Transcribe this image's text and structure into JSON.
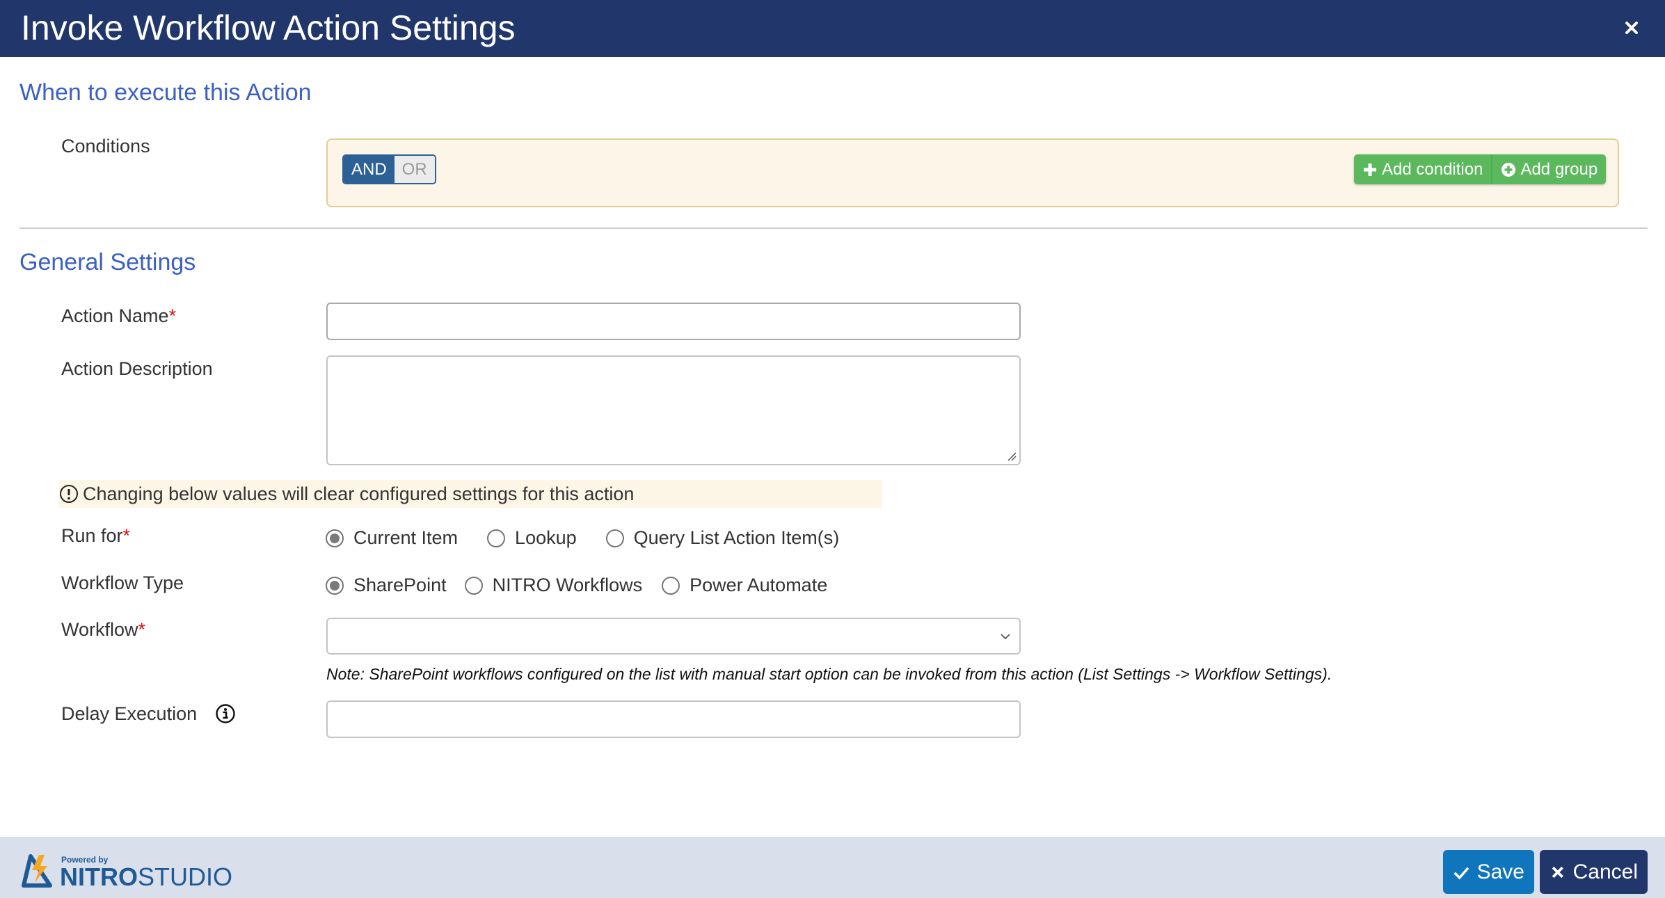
{
  "window": {
    "title": "Invoke Workflow Action Settings",
    "close_icon": "close-icon"
  },
  "when_section": {
    "heading": "When to execute this Action",
    "conditions_label": "Conditions",
    "logic_toggle": {
      "options": [
        "AND",
        "OR"
      ],
      "selected": "AND"
    },
    "add_condition_label": "Add condition",
    "add_group_label": "Add group"
  },
  "general_section": {
    "heading": "General Settings",
    "action_name": {
      "label": "Action Name",
      "required_mark": "*",
      "value": ""
    },
    "action_description": {
      "label": "Action Description",
      "value": ""
    },
    "warning": "Changing below values will clear configured settings for this action",
    "run_for": {
      "label": "Run for",
      "required_mark": "*",
      "options": [
        "Current Item",
        "Lookup",
        "Query List Action Item(s)"
      ],
      "selected": "Current Item"
    },
    "workflow_type": {
      "label": "Workflow Type",
      "options": [
        "SharePoint",
        "NITRO Workflows",
        "Power Automate"
      ],
      "selected": "SharePoint"
    },
    "workflow": {
      "label": "Workflow",
      "required_mark": "*",
      "selected_value": "",
      "note": "Note: SharePoint workflows configured on the list with manual start option can be invoked from this action (List Settings -> Workflow Settings)."
    },
    "delay_execution": {
      "label": "Delay Execution",
      "value": ""
    }
  },
  "footer": {
    "powered_by": "Powered by",
    "brand_bold": "NITRO",
    "brand_light": "STUDIO",
    "save_label": "Save",
    "cancel_label": "Cancel"
  },
  "colors": {
    "titlebar": "#21366b",
    "heading": "#3b5fc4",
    "green_button": "#5cb85c",
    "save_button": "#0f75bd",
    "cancel_button": "#21366b",
    "required": "#e01010"
  }
}
